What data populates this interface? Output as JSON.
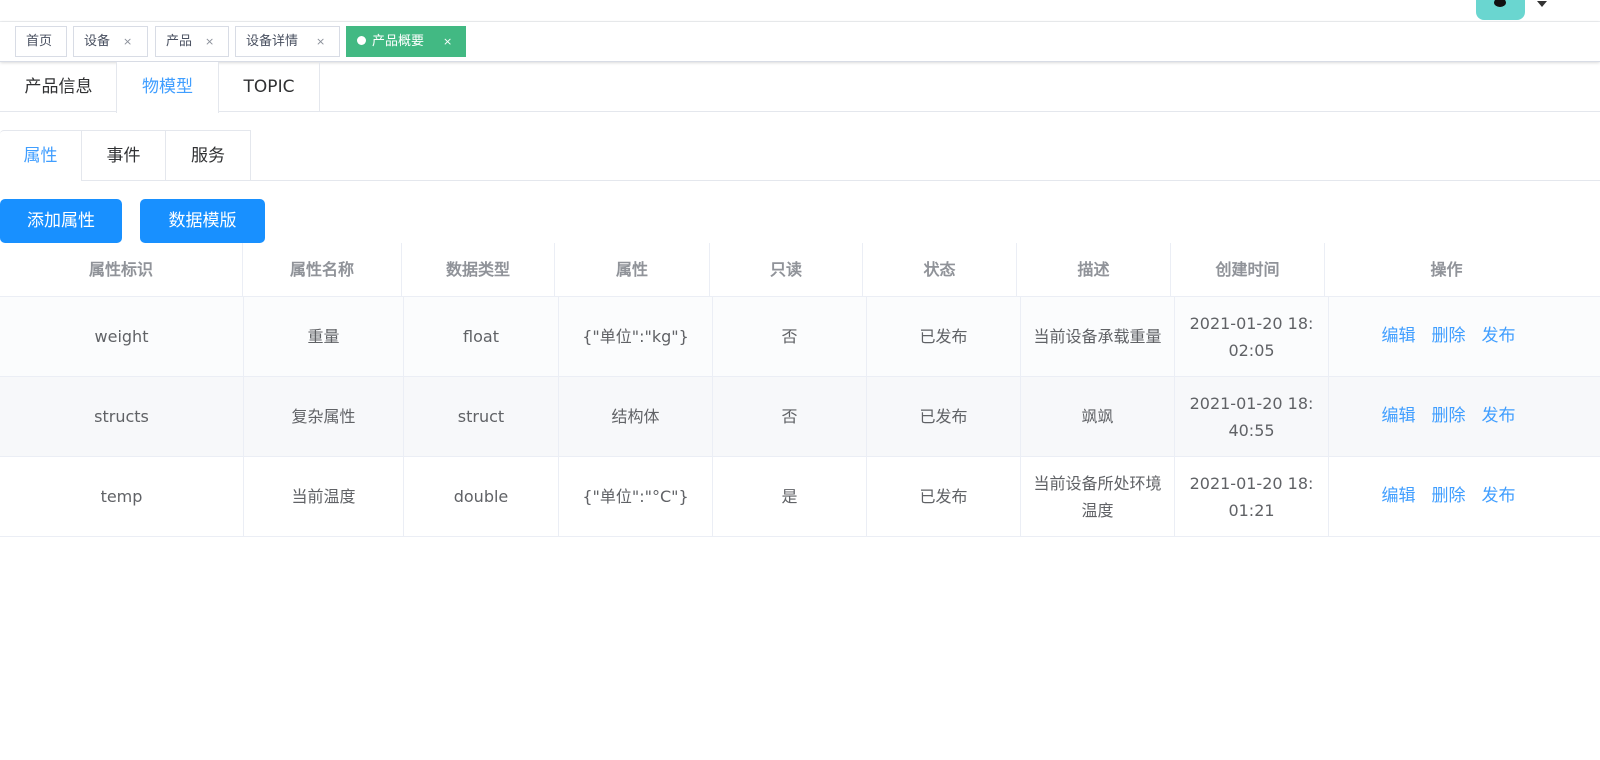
{
  "tags_view": {
    "tags": [
      {
        "label": "首页",
        "closable": false,
        "active": false
      },
      {
        "label": "设备",
        "closable": true,
        "active": false
      },
      {
        "label": "产品",
        "closable": true,
        "active": false
      },
      {
        "label": "设备详情",
        "closable": true,
        "active": false
      },
      {
        "label": "产品概要",
        "closable": true,
        "active": true
      }
    ],
    "close_glyph": "×",
    "active_color": "#42b983"
  },
  "main_tabs": {
    "items": [
      "产品信息",
      "物模型",
      "TOPIC"
    ],
    "active": "物模型"
  },
  "sub_tabs": {
    "items": [
      "属性",
      "事件",
      "服务"
    ],
    "active": "属性"
  },
  "toolbar": {
    "add_label": "添加属性",
    "template_label": "数据模版",
    "button_color": "#1890ff"
  },
  "table": {
    "columns": [
      "属性标识",
      "属性名称",
      "数据类型",
      "属性",
      "只读",
      "状态",
      "描述",
      "创建时间",
      "操作"
    ],
    "rows": [
      {
        "identifier": "weight",
        "name": "重量",
        "data_type": "float",
        "spec": "{\"单位\":\"kg\"}",
        "readonly": "否",
        "status": "已发布",
        "description": "当前设备承载重量",
        "created": "2021-01-20 18:02:05"
      },
      {
        "identifier": "structs",
        "name": "复杂属性",
        "data_type": "struct",
        "spec": "结构体",
        "readonly": "否",
        "status": "已发布",
        "description": "飒飒",
        "created": "2021-01-20 18:40:55"
      },
      {
        "identifier": "temp",
        "name": "当前温度",
        "data_type": "double",
        "spec": "{\"单位\":\"°C\"}",
        "readonly": "是",
        "status": "已发布",
        "description": "当前设备所处环境温度",
        "created": "2021-01-20 18:01:21"
      }
    ],
    "actions": {
      "edit": "编辑",
      "delete": "删除",
      "publish": "发布"
    },
    "link_color": "#409eff"
  },
  "icons": {
    "avatar": "avatar-icon",
    "caret": "caret-down-icon"
  }
}
